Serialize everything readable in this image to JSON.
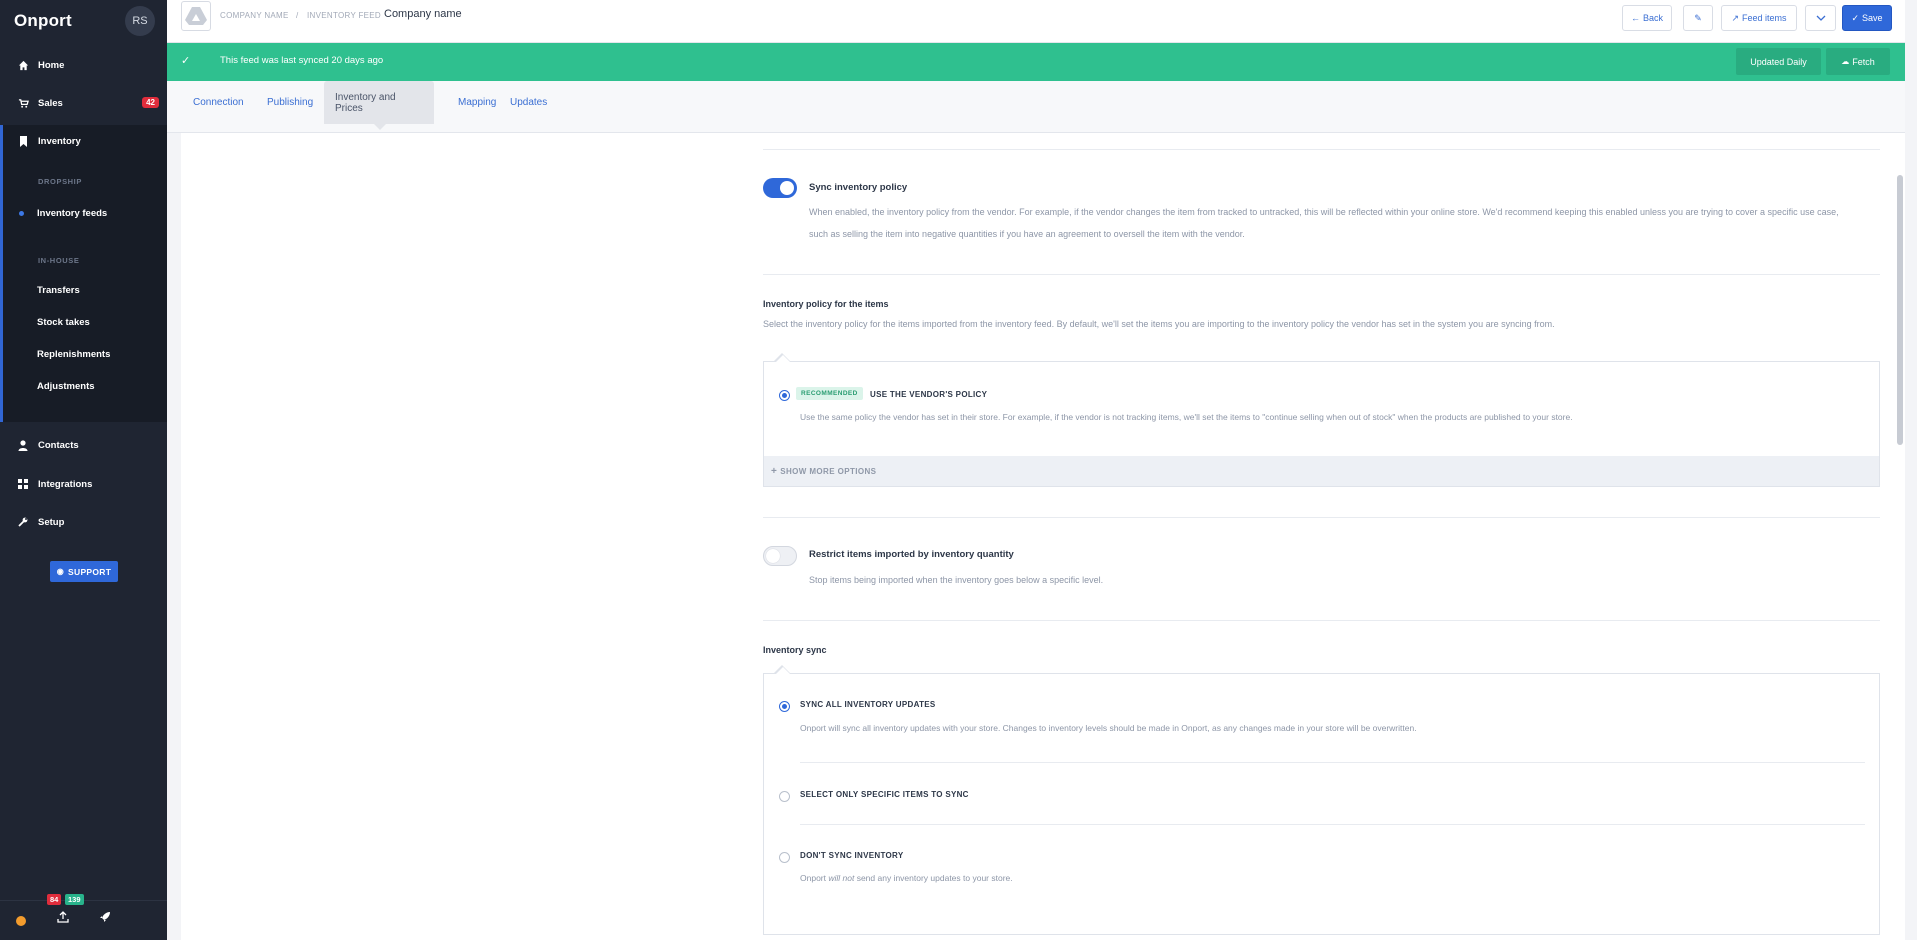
{
  "sidebar": {
    "logo": "Onport",
    "avatar_initials": "RS",
    "nav": [
      {
        "label": "Home",
        "icon": "home-icon"
      },
      {
        "label": "Sales",
        "icon": "cart-icon",
        "badge": "42"
      },
      {
        "label": "Inventory",
        "icon": "bookmark-icon"
      },
      {
        "label": "Contacts",
        "icon": "person-icon"
      },
      {
        "label": "Integrations",
        "icon": "grid-icon"
      },
      {
        "label": "Setup",
        "icon": "wrench-icon"
      }
    ],
    "inventory_sections": {
      "dropship_label": "DROPSHIP",
      "inhouse_label": "IN-HOUSE",
      "dropship_items": [
        "Inventory feeds"
      ],
      "inhouse_items": [
        "Transfers",
        "Stock takes",
        "Replenishments",
        "Adjustments"
      ]
    },
    "support_label": "SUPPORT",
    "bottom": {
      "red_badge": "84",
      "green_badge": "139"
    }
  },
  "header": {
    "breadcrumb_1": "COMPANY NAME",
    "breadcrumb_sep": "/",
    "breadcrumb_2": "INVENTORY FEED",
    "title": "Company name",
    "back_label": "Back",
    "feed_items_label": "Feed items",
    "save_label": "Save"
  },
  "banner": {
    "message": "This feed was last synced 20 days ago",
    "updated_label": "Updated Daily",
    "fetch_label": "Fetch",
    "color": "#2fc08f"
  },
  "tabs": [
    "Connection",
    "Publishing",
    "Inventory and Prices",
    "Mapping",
    "Updates"
  ],
  "active_tab": "Inventory and Prices",
  "sync_policy": {
    "enabled": true,
    "title": "Sync inventory policy",
    "desc_line1": "When enabled, the inventory policy from the vendor. For example, if the vendor changes the item from tracked to untracked, this will be reflected within your online store. We'd recommend keeping this enabled unless you are trying to cover a specific use case,",
    "desc_line2": "such as selling the item into negative quantities if you have an agreement to oversell the item with the vendor."
  },
  "policy_for_items": {
    "title": "Inventory policy for the items",
    "desc": "Select the inventory policy for the items imported from the inventory feed. By default, we'll set the items you are importing to the inventory policy the vendor has set in the system you are syncing from.",
    "recommended_badge": "RECOMMENDED",
    "option_label": "USE THE VENDOR'S POLICY",
    "option_desc": "Use the same policy the vendor has set in their store. For example, if the vendor is not tracking items, we'll set the items to \"continue selling when out of stock\" when the products are published to your store.",
    "show_more": "SHOW MORE OPTIONS"
  },
  "restrict": {
    "enabled": false,
    "title": "Restrict items imported by inventory quantity",
    "desc": "Stop items being imported when the inventory goes below a specific level."
  },
  "inventory_sync": {
    "title": "Inventory sync",
    "options": [
      {
        "label": "SYNC ALL INVENTORY UPDATES",
        "selected": true,
        "desc": "Onport will sync all inventory updates with your store. Changes to inventory levels should be made in Onport, as any changes made in your store will be overwritten."
      },
      {
        "label": "SELECT ONLY SPECIFIC ITEMS TO SYNC",
        "selected": false
      },
      {
        "label": "DON'T SYNC INVENTORY",
        "selected": false,
        "desc_pre": "Onport ",
        "desc_em": "will not",
        "desc_post": " send any inventory updates to your store."
      }
    ]
  }
}
